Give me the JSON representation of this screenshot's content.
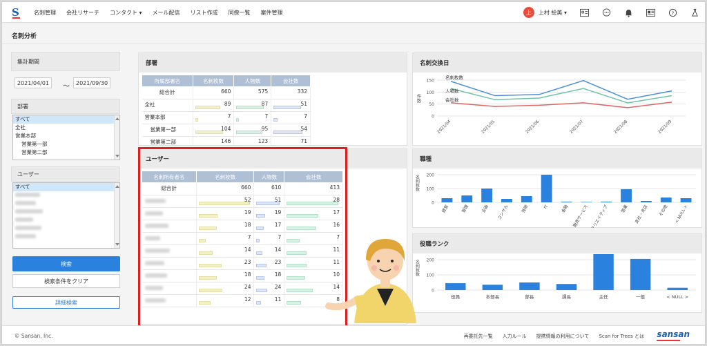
{
  "nav": {
    "items": [
      "名刺管理",
      "会社リサーチ",
      "コンタクト ▾",
      "メール配信",
      "リスト作成",
      "同僚一覧",
      "案件管理"
    ],
    "avatar_char": "上",
    "user_name": "上村 絵美 ▾"
  },
  "page_title": "名刺分析",
  "sidebar": {
    "period_label": "集計期間",
    "date_from": "2021/04/01",
    "tilde": "〜",
    "date_to": "2021/09/30",
    "dept_label": "部署",
    "dept_options": [
      "すべて",
      "全社",
      "営業本部",
      "営業第一部",
      "営業第二部"
    ],
    "user_label": "ユーザー",
    "user_options": [
      "すべて"
    ],
    "search_button": "検索",
    "clear_button": "検索条件をクリア",
    "advanced_button": "詳細検索"
  },
  "dept_panel": {
    "title": "部署",
    "headers": [
      "所属部署名",
      "名刺枚数",
      "人物数",
      "会社数"
    ],
    "rows": [
      {
        "name": "総合計",
        "cards": "660",
        "people": "575",
        "companies": "332"
      },
      {
        "name": "全社",
        "cards": "89",
        "people": "87",
        "companies": "51"
      },
      {
        "name": "営業本部",
        "cards": "7",
        "people": "7",
        "companies": "7"
      },
      {
        "name": "営業第一部",
        "cards": "104",
        "people": "95",
        "companies": "54"
      },
      {
        "name": "営業第二部",
        "cards": "146",
        "people": "123",
        "companies": "71"
      }
    ]
  },
  "user_panel": {
    "title": "ユーザー",
    "headers": [
      "名刺所有者名",
      "名刺枚数",
      "人物数",
      "会社数"
    ],
    "total": {
      "name": "総合計",
      "cards": "660",
      "people": "610",
      "companies": "413"
    },
    "rows": [
      {
        "cards": "52",
        "people": "51",
        "companies": "28"
      },
      {
        "cards": "19",
        "people": "19",
        "companies": "17"
      },
      {
        "cards": "18",
        "people": "17",
        "companies": "16"
      },
      {
        "cards": "7",
        "people": "7",
        "companies": "7"
      },
      {
        "cards": "14",
        "people": "14",
        "companies": "11"
      },
      {
        "cards": "23",
        "people": "23",
        "companies": "11"
      },
      {
        "cards": "18",
        "people": "18",
        "companies": "10"
      },
      {
        "cards": "24",
        "people": "24",
        "companies": "14"
      },
      {
        "cards": "12",
        "people": "11",
        "companies": "8"
      }
    ]
  },
  "chart_data": [
    {
      "type": "line",
      "title": "名刺交換日",
      "ylabel": "件数",
      "x": [
        "2021/04",
        "2021/05",
        "2021/06",
        "2021/07",
        "2021/08",
        "2021/09"
      ],
      "ylim": [
        0,
        150
      ],
      "yticks": [
        "0",
        "50",
        "100",
        "150"
      ],
      "series": [
        {
          "name": "名刺枚数",
          "values": [
            145,
            85,
            90,
            148,
            70,
            105
          ],
          "color": "#4a90d9"
        },
        {
          "name": "人物数",
          "values": [
            115,
            68,
            75,
            115,
            55,
            85
          ],
          "color": "#6cc3a6"
        },
        {
          "name": "会社数",
          "values": [
            55,
            40,
            45,
            55,
            35,
            58
          ],
          "color": "#e06666"
        }
      ]
    },
    {
      "type": "bar",
      "title": "職種",
      "ylabel": "名刺枚数",
      "ylim": [
        0,
        200
      ],
      "yticks": [
        "0",
        "100",
        "200"
      ],
      "categories": [
        "経営",
        "管理",
        "企画",
        "コンサル",
        "技術",
        "IT",
        "金融",
        "販売サービス",
        "クリエイティブ",
        "営業",
        "支社・支店",
        "その他",
        "< NULL >"
      ],
      "values": [
        30,
        50,
        100,
        25,
        45,
        200,
        5,
        3,
        5,
        95,
        10,
        35,
        30
      ],
      "color": "#2b82de"
    },
    {
      "type": "bar",
      "title": "役職ランク",
      "ylabel": "名刺枚数",
      "ylim": [
        0,
        200
      ],
      "yticks": [
        "0",
        "100",
        "200"
      ],
      "categories": [
        "役員",
        "本部長",
        "部長",
        "課長",
        "主任",
        "一般",
        "< NULL >"
      ],
      "values": [
        45,
        35,
        50,
        40,
        240,
        205,
        15
      ],
      "color": "#2b82de"
    }
  ],
  "footer": {
    "copyright": "© Sansan, Inc.",
    "links": [
      "再委託先一覧",
      "入力ルール",
      "提携情報の利用について",
      "Scan for Trees とは"
    ],
    "brand": "sansan"
  },
  "colors": {
    "primary": "#2b82de",
    "highlight": "#e01e1e",
    "header_blue": "#aebfd6"
  }
}
